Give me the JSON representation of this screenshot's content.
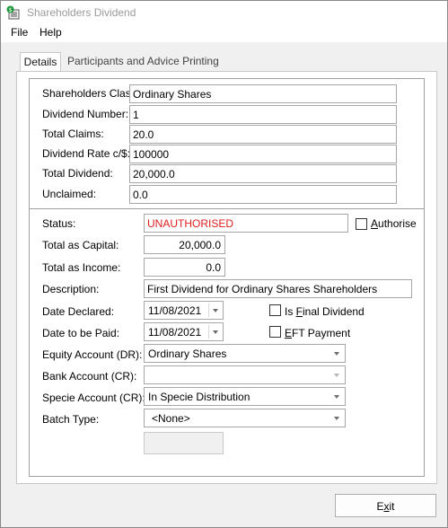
{
  "window": {
    "title": "Shareholders Dividend"
  },
  "menu": {
    "file": "File",
    "help": "Help"
  },
  "tabs": {
    "details": "Details",
    "participants": "Participants and Advice Printing"
  },
  "fields": {
    "shareholders_class": {
      "label": "Shareholders Class:",
      "value": "Ordinary Shares"
    },
    "dividend_number": {
      "label": "Dividend Number:",
      "value": "1"
    },
    "total_claims": {
      "label": "Total Claims:",
      "value": "20.0"
    },
    "dividend_rate": {
      "label": "Dividend Rate c/$:",
      "value": "100000"
    },
    "total_dividend": {
      "label": "Total Dividend:",
      "value": "20,000.0"
    },
    "unclaimed": {
      "label": "Unclaimed:",
      "value": "0.0"
    },
    "status": {
      "label": "Status:",
      "value": "UNAUTHORISED"
    },
    "authorise": {
      "label_pre": "",
      "label_ul": "A",
      "label_post": "uthorise",
      "checked": false
    },
    "total_capital": {
      "label": "Total as Capital:",
      "value": "20,000.0"
    },
    "total_income": {
      "label": "Total as Income:",
      "value": "0.0"
    },
    "description": {
      "label": "Description:",
      "value": "First Dividend for Ordinary Shares Shareholders"
    },
    "date_declared": {
      "label": "Date Declared:",
      "value": "11/08/2021"
    },
    "is_final": {
      "label_pre": "Is ",
      "label_ul": "F",
      "label_post": "inal Dividend",
      "checked": false
    },
    "date_paid": {
      "label": "Date to be Paid:",
      "value": "11/08/2021"
    },
    "eft": {
      "label_pre": "",
      "label_ul": "E",
      "label_post": "FT Payment",
      "checked": false
    },
    "equity_account": {
      "label": "Equity Account (DR):",
      "value": "Ordinary Shares"
    },
    "bank_account": {
      "label": "Bank Account (CR):",
      "value": ""
    },
    "specie_account": {
      "label": "Specie Account (CR):",
      "value": "In Specie Distribution"
    },
    "batch_type": {
      "label": "Batch Type:",
      "value": "<None>"
    }
  },
  "buttons": {
    "exit_pre": "E",
    "exit_ul": "x",
    "exit_post": "it"
  }
}
